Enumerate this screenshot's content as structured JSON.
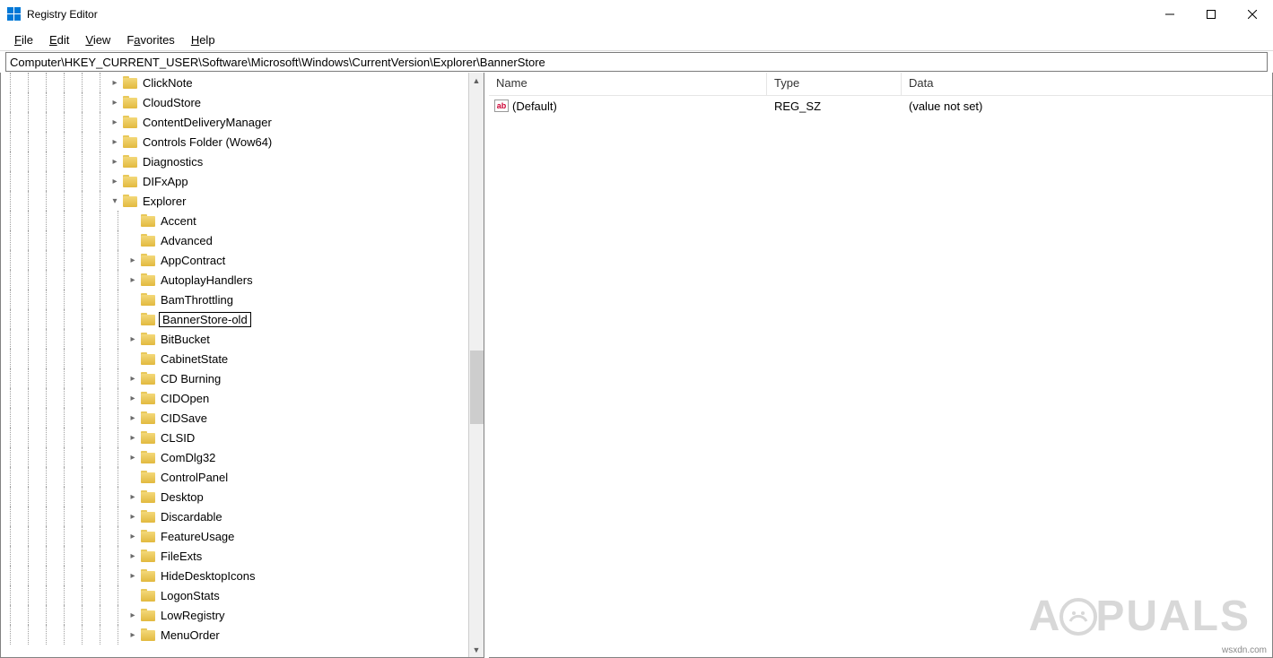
{
  "window": {
    "title": "Registry Editor"
  },
  "menu": {
    "file": "File",
    "edit": "Edit",
    "view": "View",
    "favorites": "Favorites",
    "help": "Help"
  },
  "pathbar": {
    "value": "Computer\\HKEY_CURRENT_USER\\Software\\Microsoft\\Windows\\CurrentVersion\\Explorer\\BannerStore"
  },
  "tree": {
    "preNodes": [
      {
        "depth": 6,
        "name": "ClickNote",
        "expander": "closed"
      },
      {
        "depth": 6,
        "name": "CloudStore",
        "expander": "closed"
      },
      {
        "depth": 6,
        "name": "ContentDeliveryManager",
        "expander": "closed"
      },
      {
        "depth": 6,
        "name": "Controls Folder (Wow64)",
        "expander": "closed"
      },
      {
        "depth": 6,
        "name": "Diagnostics",
        "expander": "closed"
      },
      {
        "depth": 6,
        "name": "DIFxApp",
        "expander": "closed"
      },
      {
        "depth": 6,
        "name": "Explorer",
        "expander": "open"
      }
    ],
    "explorerChildren": [
      {
        "name": "Accent",
        "expander": "none"
      },
      {
        "name": "Advanced",
        "expander": "none"
      },
      {
        "name": "AppContract",
        "expander": "closed"
      },
      {
        "name": "AutoplayHandlers",
        "expander": "closed"
      },
      {
        "name": "BamThrottling",
        "expander": "none"
      },
      {
        "name": "BannerStore-old",
        "expander": "none",
        "editing": true,
        "selected": true
      },
      {
        "name": "BitBucket",
        "expander": "closed"
      },
      {
        "name": "CabinetState",
        "expander": "none"
      },
      {
        "name": "CD Burning",
        "expander": "closed"
      },
      {
        "name": "CIDOpen",
        "expander": "closed"
      },
      {
        "name": "CIDSave",
        "expander": "closed"
      },
      {
        "name": "CLSID",
        "expander": "closed"
      },
      {
        "name": "ComDlg32",
        "expander": "closed"
      },
      {
        "name": "ControlPanel",
        "expander": "none"
      },
      {
        "name": "Desktop",
        "expander": "closed"
      },
      {
        "name": "Discardable",
        "expander": "closed"
      },
      {
        "name": "FeatureUsage",
        "expander": "closed"
      },
      {
        "name": "FileExts",
        "expander": "closed"
      },
      {
        "name": "HideDesktopIcons",
        "expander": "closed"
      },
      {
        "name": "LogonStats",
        "expander": "none"
      },
      {
        "name": "LowRegistry",
        "expander": "closed"
      },
      {
        "name": "MenuOrder",
        "expander": "closed"
      }
    ]
  },
  "list": {
    "columns": {
      "name": "Name",
      "type": "Type",
      "data": "Data"
    },
    "rows": [
      {
        "name": "(Default)",
        "type": "REG_SZ",
        "data": "(value not set)"
      }
    ]
  },
  "watermark": {
    "prefix": "A",
    "suffix": "PUALS",
    "site": "wsxdn.com"
  }
}
